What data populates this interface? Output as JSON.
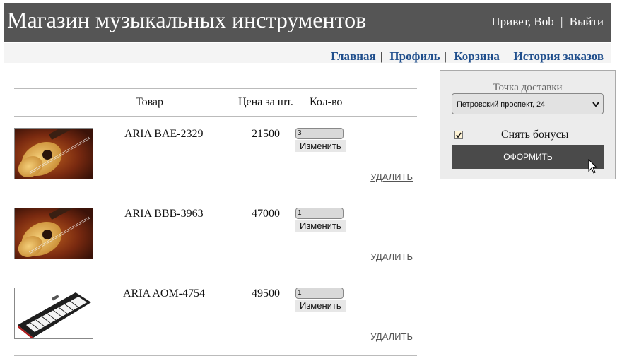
{
  "header": {
    "title": "Магазин музыкальных инструментов",
    "greeting": "Привет, Bob",
    "separator": "|",
    "logout": "Выйти"
  },
  "nav": {
    "items": [
      {
        "label": "Главная"
      },
      {
        "label": "Профиль"
      },
      {
        "label": "Корзина"
      },
      {
        "label": "История заказов"
      }
    ],
    "separator": "|"
  },
  "cart": {
    "columns": {
      "product": "Товар",
      "price": "Цена за шт.",
      "qty": "Кол-во"
    },
    "update_label": "Изменить",
    "delete_label": "УДАЛИТЬ",
    "items": [
      {
        "name": "ARIA BAE-2329",
        "price": "21500",
        "qty": "3",
        "image": "acoustic-guitar"
      },
      {
        "name": "ARIA BBB-3963",
        "price": "47000",
        "qty": "1",
        "image": "acoustic-guitar"
      },
      {
        "name": "ARIA AOM-4754",
        "price": "49500",
        "qty": "1",
        "image": "synthesizer-keyboard"
      }
    ]
  },
  "delivery": {
    "title": "Точка доставки",
    "selected": "Петровский проспект, 24",
    "bonus_label": "Снять бонусы",
    "bonus_checked": true,
    "checkout_label": "ОФОРМИТЬ"
  }
}
